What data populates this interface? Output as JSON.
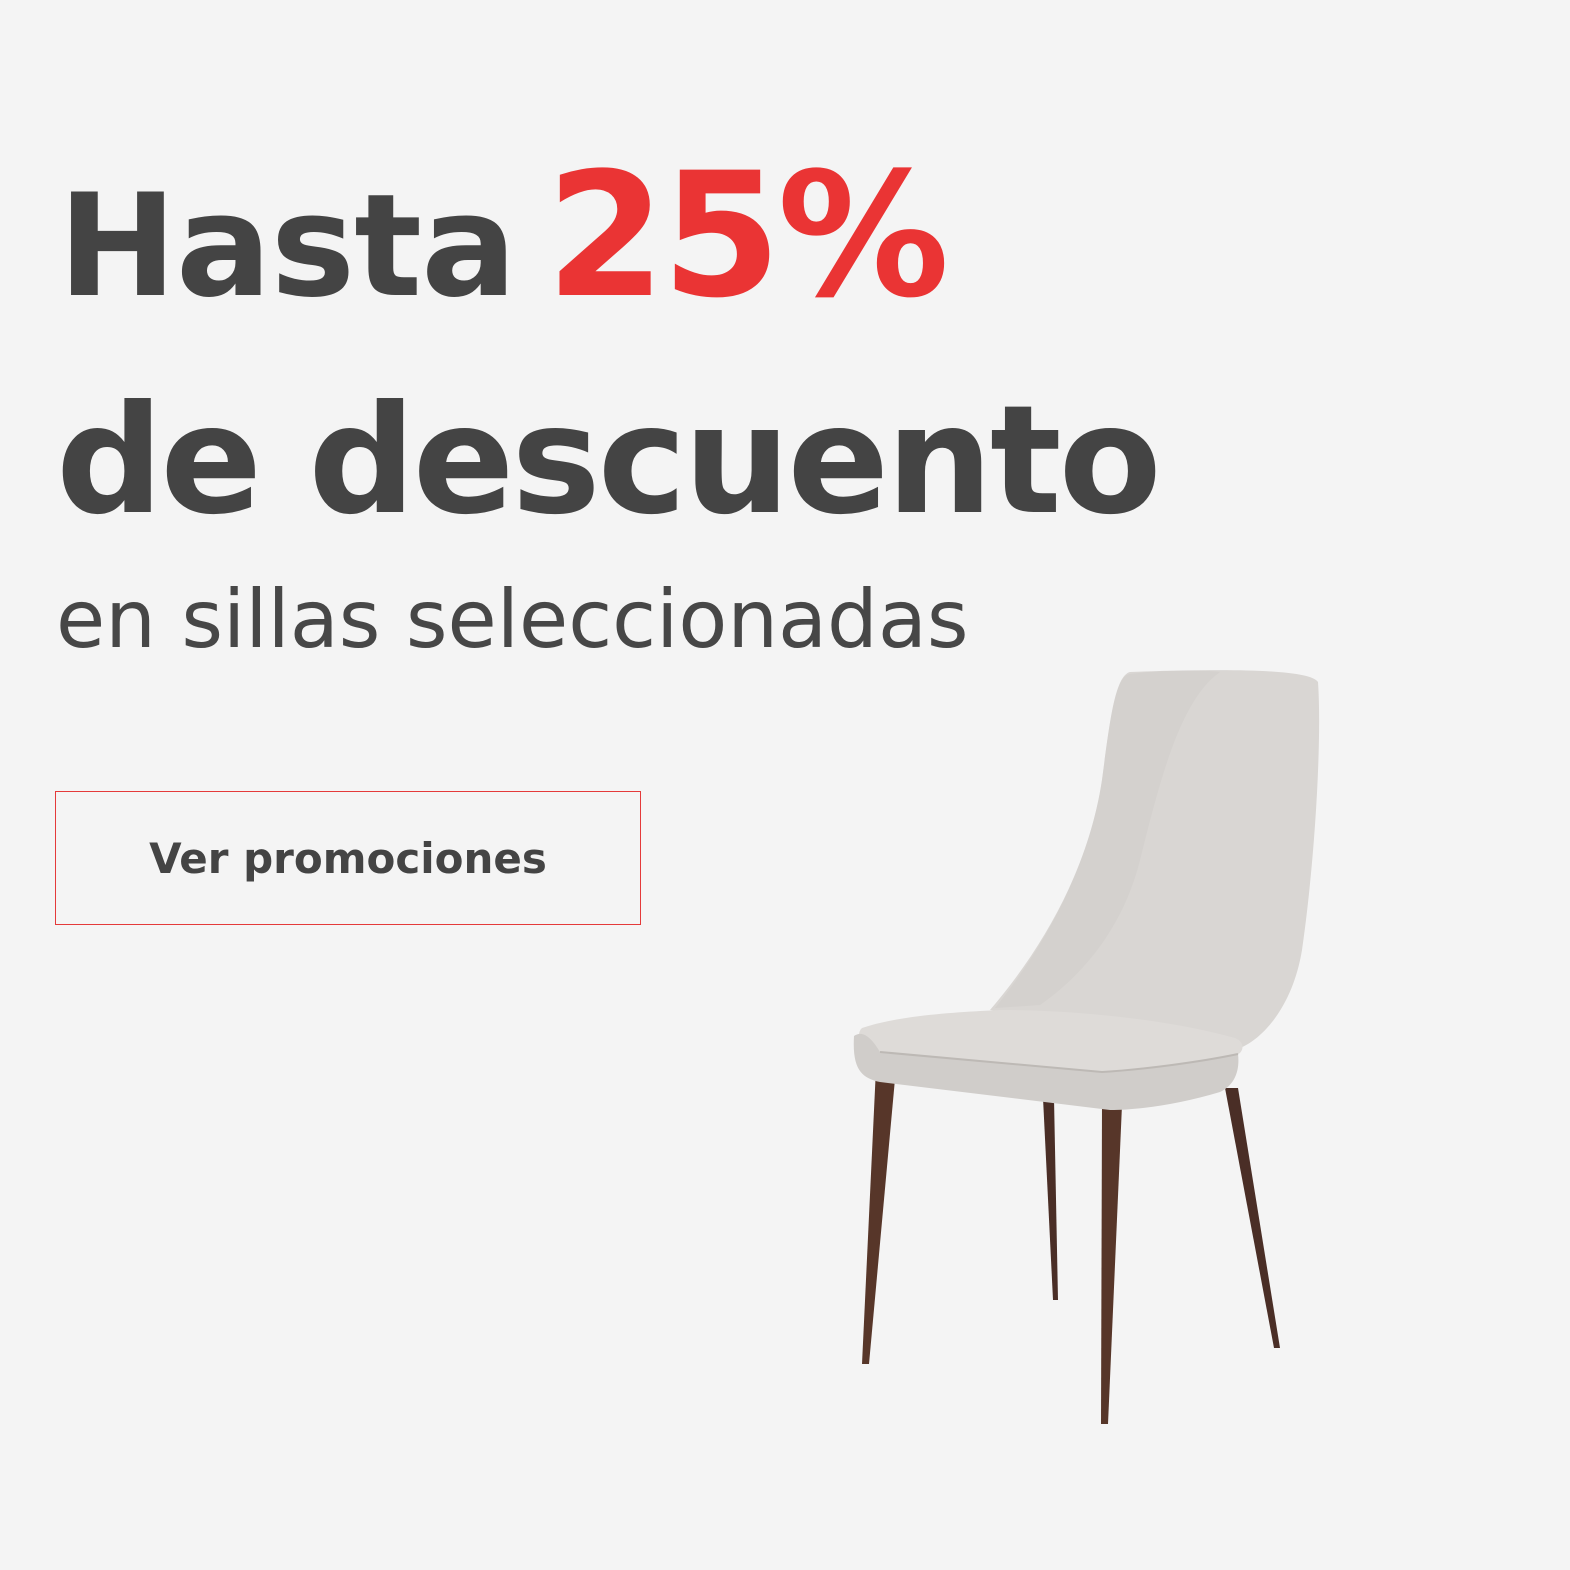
{
  "promo": {
    "headline_word": "Hasta",
    "headline_percent": "25%",
    "headline_line2": "de descuento",
    "subheadline": "en sillas seleccionadas",
    "cta_label": "Ver promociones"
  },
  "colors": {
    "background": "#f4f4f4",
    "text_dark": "#444444",
    "accent_red": "#ea3434",
    "chair_fabric": "#d9d6d3",
    "chair_legs": "#4a2e26"
  },
  "image": {
    "subject": "chair-image"
  }
}
